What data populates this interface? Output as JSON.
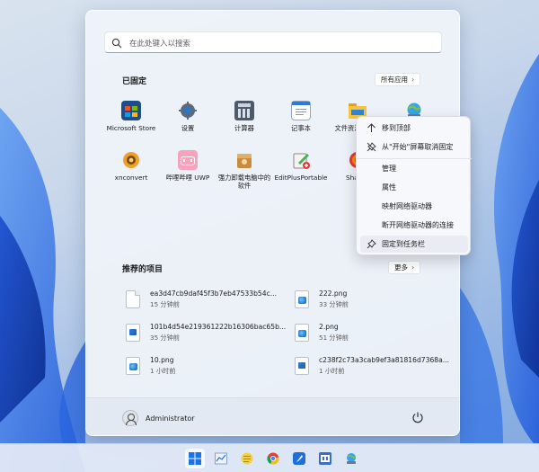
{
  "colors": {
    "accent": "#0067c0",
    "start_bg": "#eef2f9",
    "taskbar_bg": "#e2e9f5",
    "context_bg": "#f7f8fb"
  },
  "search": {
    "placeholder": "在此处键入以搜索",
    "icon": "search-icon"
  },
  "pinned": {
    "title": "已固定",
    "all_apps_label": "所有应用",
    "apps": [
      {
        "label": "Microsoft Store",
        "icon": "microsoft-store-icon"
      },
      {
        "label": "设置",
        "icon": "settings-gear-icon"
      },
      {
        "label": "计算器",
        "icon": "calculator-icon"
      },
      {
        "label": "记事本",
        "icon": "notepad-icon"
      },
      {
        "label": "文件资源管理器",
        "icon": "file-explorer-icon"
      },
      {
        "label": "",
        "icon": "network-drive-icon"
      },
      {
        "label": "xnconvert",
        "icon": "xnconvert-icon"
      },
      {
        "label": "哔哩哔哩 UWP",
        "icon": "bilibili-icon"
      },
      {
        "label": "强力卸载电脑中的软件",
        "icon": "uninstaller-icon"
      },
      {
        "label": "EditPlusPortable",
        "icon": "editplus-icon"
      },
      {
        "label": "ShareX",
        "icon": "sharex-icon"
      }
    ]
  },
  "recommended": {
    "title": "推荐的项目",
    "more_label": "更多",
    "items": [
      {
        "name": "ea3d47cb9daf45f3b7eb47533b54c...",
        "time": "15 分钟前",
        "icon": "blank-file-icon"
      },
      {
        "name": "222.png",
        "time": "33 分钟前",
        "icon": "png-file-icon"
      },
      {
        "name": "101b4d54e219361222b16306bac65b...",
        "time": "35 分钟前",
        "icon": "image-file-icon"
      },
      {
        "name": "2.png",
        "time": "51 分钟前",
        "icon": "png-file-icon"
      },
      {
        "name": "10.png",
        "time": "1 小时前",
        "icon": "png-file-icon"
      },
      {
        "name": "c238f2c73a3cab9ef3a81816d7368a...",
        "time": "1 小时前",
        "icon": "image-file-icon"
      }
    ]
  },
  "user": {
    "name": "Administrator"
  },
  "context_menu": {
    "items": [
      {
        "label": "移到顶部",
        "icon": "arrow-up-icon"
      },
      {
        "label": "从\"开始\"屏幕取消固定",
        "icon": "unpin-icon"
      },
      {
        "label": "管理",
        "icon": ""
      },
      {
        "label": "属性",
        "icon": ""
      },
      {
        "label": "映射网络驱动器",
        "icon": ""
      },
      {
        "label": "断开网络驱动器的连接",
        "icon": ""
      },
      {
        "label": "固定到任务栏",
        "icon": "pin-icon"
      }
    ]
  },
  "taskbar": {
    "items": [
      "start-windows-icon",
      "chart-app-icon",
      "notes-app-icon",
      "chrome-icon",
      "feather-app-icon",
      "sharex-s3-icon",
      "network-drive-icon"
    ]
  }
}
